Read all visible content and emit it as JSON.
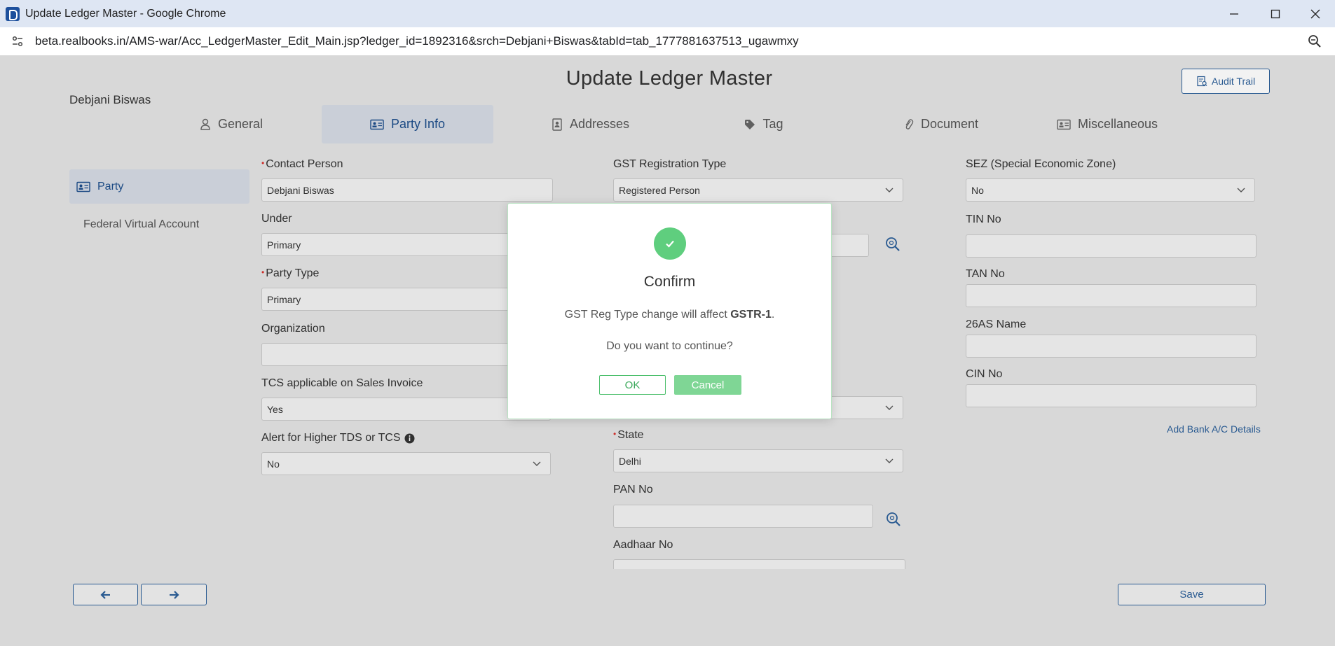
{
  "window": {
    "title": "Update Ledger Master - Google Chrome",
    "url": "beta.realbooks.in/AMS-war/Acc_LedgerMaster_Edit_Main.jsp?ledger_id=1892316&srch=Debjani+Biswas&tabId=tab_1777881637513_ugawmxy"
  },
  "header": {
    "page_title": "Update Ledger Master",
    "audit_trail_label": "Audit Trail",
    "party_name": "Debjani Biswas"
  },
  "tabs": [
    {
      "label": "General",
      "icon": "user-icon",
      "active": false
    },
    {
      "label": "Party Info",
      "icon": "id-card-icon",
      "active": true
    },
    {
      "label": "Addresses",
      "icon": "contact-book-icon",
      "active": false
    },
    {
      "label": "Tag",
      "icon": "tag-icon",
      "active": false
    },
    {
      "label": "Document",
      "icon": "paperclip-icon",
      "active": false
    },
    {
      "label": "Miscellaneous",
      "icon": "id-card-icon",
      "active": false
    }
  ],
  "sidenav": [
    {
      "label": "Party",
      "active": true
    },
    {
      "label": "Federal Virtual Account",
      "active": false
    }
  ],
  "form": {
    "contact_person": {
      "label": "Contact Person",
      "value": "Debjani Biswas"
    },
    "under": {
      "label": "Under",
      "value": "Primary"
    },
    "party_type": {
      "label": "Party Type",
      "value": "Primary"
    },
    "organization": {
      "label": "Organization",
      "value": ""
    },
    "tcs_applicable": {
      "label": "TCS applicable on Sales Invoice",
      "value": "Yes"
    },
    "alert_higher_tds": {
      "label": "Alert for Higher TDS or TCS",
      "value": "No"
    },
    "gst_reg_type": {
      "label": "GST Registration Type",
      "value": "Registered Person"
    },
    "state": {
      "label": "State",
      "value": "Delhi"
    },
    "pan_no": {
      "label": "PAN No",
      "value": ""
    },
    "aadhaar_no": {
      "label": "Aadhaar No",
      "value": ""
    },
    "sez": {
      "label": "SEZ (Special Economic Zone)",
      "value": "No"
    },
    "tin_no": {
      "label": "TIN No",
      "value": ""
    },
    "tan_no": {
      "label": "TAN No",
      "value": ""
    },
    "name_26as": {
      "label": "26AS Name",
      "value": ""
    },
    "cin_no": {
      "label": "CIN No",
      "value": ""
    },
    "add_bank_link": "Add Bank A/C Details"
  },
  "footer": {
    "save_label": "Save"
  },
  "modal": {
    "title": "Confirm",
    "message_prefix": "GST Reg Type change will affect ",
    "message_bold": "GSTR-1",
    "message_suffix": ".",
    "question": "Do you want to continue?",
    "ok_label": "OK",
    "cancel_label": "Cancel"
  },
  "colors": {
    "accent": "#2c5f99",
    "success": "#5fce7e",
    "required": "#d9302c"
  }
}
